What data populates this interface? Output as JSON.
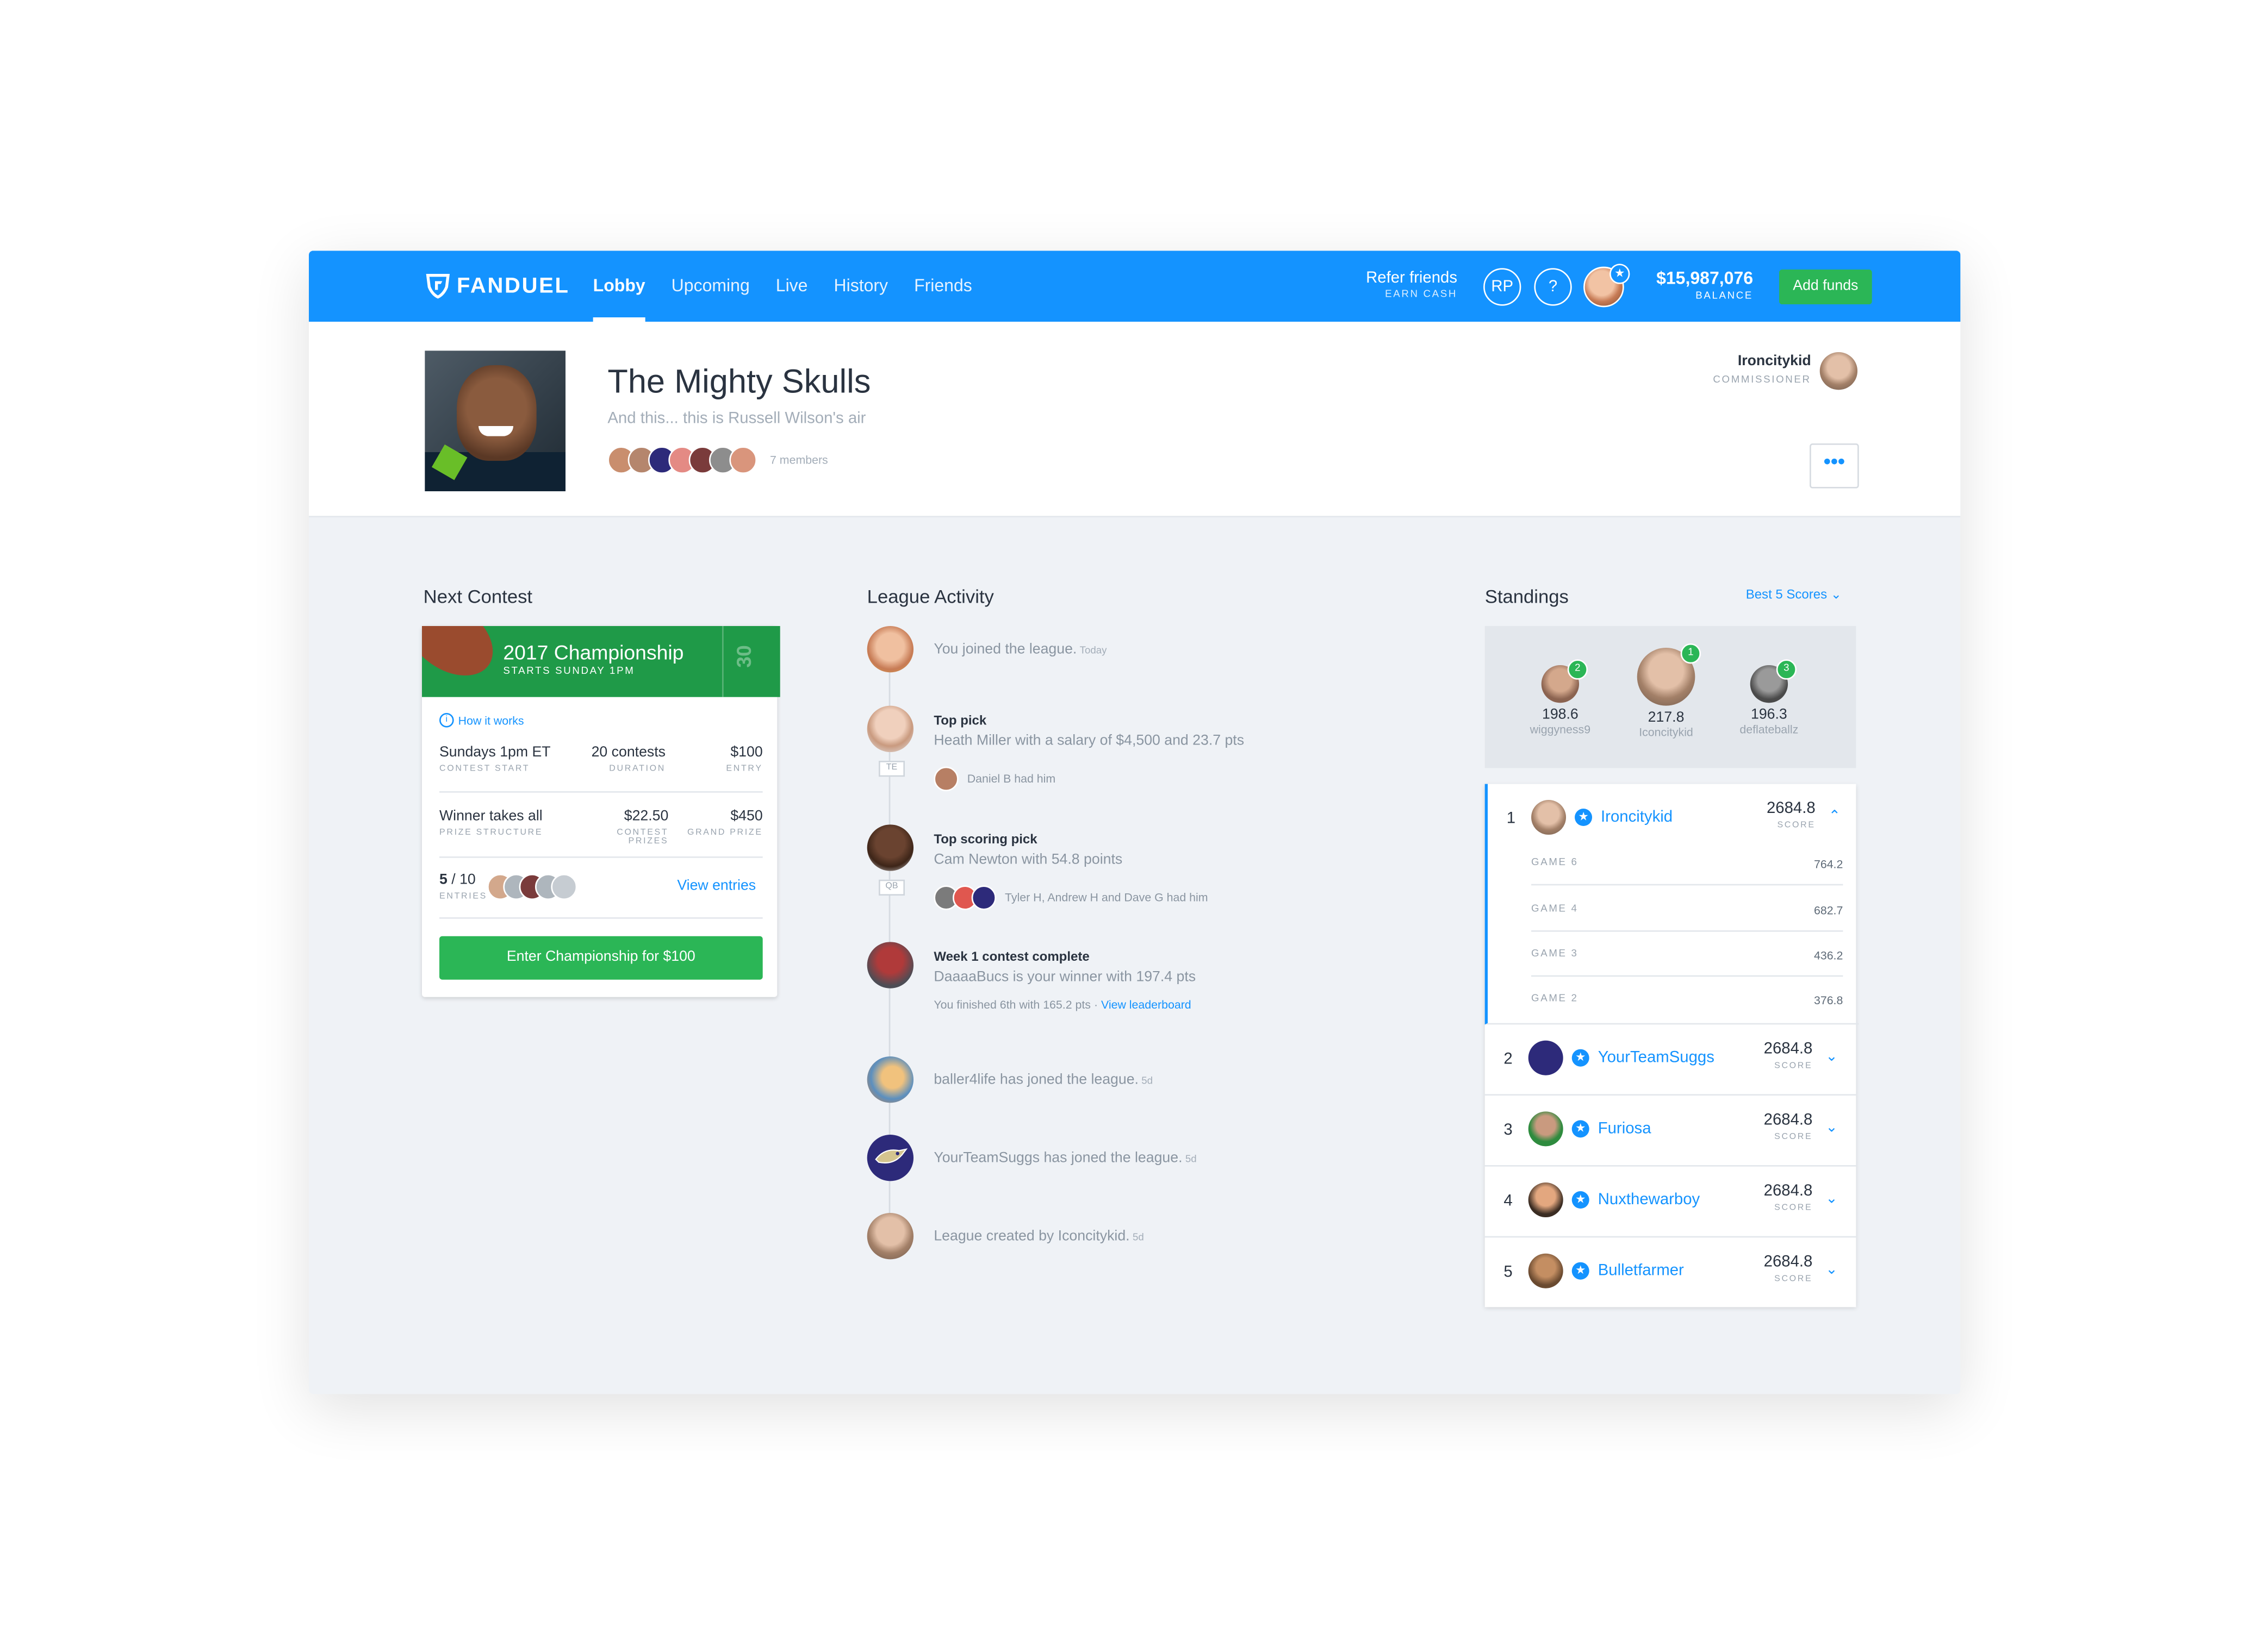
{
  "nav": {
    "brand": "FANDUEL",
    "links": [
      "Lobby",
      "Upcoming",
      "Live",
      "History",
      "Friends"
    ],
    "active": "Lobby",
    "refer_title": "Refer friends",
    "refer_sub": "EARN CASH",
    "rp_label": "RP",
    "help_label": "?",
    "balance_value": "$15,987,076",
    "balance_label": "BALANCE",
    "add_funds": "Add funds"
  },
  "league": {
    "title": "The Mighty Skulls",
    "subtitle": "And this... this is Russell Wilson's air",
    "members_count": "7 members",
    "commissioner_name": "Ironcitykid",
    "commissioner_label": "COMMISSIONER",
    "more_label": "•••"
  },
  "next_contest": {
    "heading": "Next Contest",
    "title": "2017 Championship",
    "starts": "STARTS SUNDAY 1PM",
    "yard": "30",
    "how_it_works": "How it works",
    "start_value": "Sundays 1pm ET",
    "start_label": "CONTEST START",
    "duration_value": "20 contests",
    "duration_label": "DURATION",
    "entry_value": "$100",
    "entry_label": "ENTRY",
    "prize_value": "Winner takes all",
    "prize_label": "PRIZE STRUCTURE",
    "contest_prizes_value": "$22.50",
    "contest_prizes_label": "CONTEST PRIZES",
    "grand_prize_value": "$450",
    "grand_prize_label": "GRAND PRIZE",
    "entries_current": "5",
    "entries_total": "/ 10",
    "entries_label": "ENTRIES",
    "view_entries": "View entries",
    "enter_button": "Enter Championship for $100"
  },
  "activity": {
    "heading": "League Activity",
    "items": [
      {
        "text": "You joined the league.",
        "time": "Today"
      },
      {
        "title": "Top pick",
        "text": "Heath Miller with a salary of $4,500 and 23.7 pts",
        "pos": "TE",
        "had": "Daniel B had him"
      },
      {
        "title": "Top scoring pick",
        "text": "Cam Newton with 54.8 points",
        "pos": "QB",
        "had": "Tyler H, Andrew H and Dave G had him"
      },
      {
        "title": "Week 1 contest complete",
        "text": "DaaaaBucs is your winner with 197.4 pts",
        "finished": "You finished 6th with 165.2 pts",
        "sep": "·",
        "link": "View leaderboard"
      },
      {
        "text": "baller4life has joned the league.",
        "time": "5d"
      },
      {
        "text": "YourTeamSuggs has joned the league.",
        "time": "5d"
      },
      {
        "text": "League created by Iconcitykid.",
        "time": "5d"
      }
    ]
  },
  "standings": {
    "heading": "Standings",
    "filter": "Best 5 Scores ⌄",
    "podium": [
      {
        "rank": "2",
        "score": "198.6",
        "name": "wiggyness9"
      },
      {
        "rank": "1",
        "score": "217.8",
        "name": "Iconcitykid"
      },
      {
        "rank": "3",
        "score": "196.3",
        "name": "deflateballz"
      }
    ],
    "rows": [
      {
        "rank": "1",
        "name": "Ironcitykid",
        "score": "2684.8",
        "label": "SCORE",
        "chev": "⌃"
      },
      {
        "rank": "2",
        "name": "YourTeamSuggs",
        "score": "2684.8",
        "label": "SCORE",
        "chev": "⌄"
      },
      {
        "rank": "3",
        "name": "Furiosa",
        "score": "2684.8",
        "label": "SCORE",
        "chev": "⌄"
      },
      {
        "rank": "4",
        "name": "Nuxthewarboy",
        "score": "2684.8",
        "label": "SCORE",
        "chev": "⌄"
      },
      {
        "rank": "5",
        "name": "Bulletfarmer",
        "score": "2684.8",
        "label": "SCORE",
        "chev": "⌄"
      }
    ],
    "games": [
      {
        "label": "GAME 6",
        "value": "764.2"
      },
      {
        "label": "GAME 4",
        "value": "682.7"
      },
      {
        "label": "GAME 3",
        "value": "436.2"
      },
      {
        "label": "GAME 2",
        "value": "376.8"
      }
    ]
  },
  "colors": {
    "brand": "#1493ff",
    "success": "#2bb656",
    "background": "#eff2f6"
  }
}
